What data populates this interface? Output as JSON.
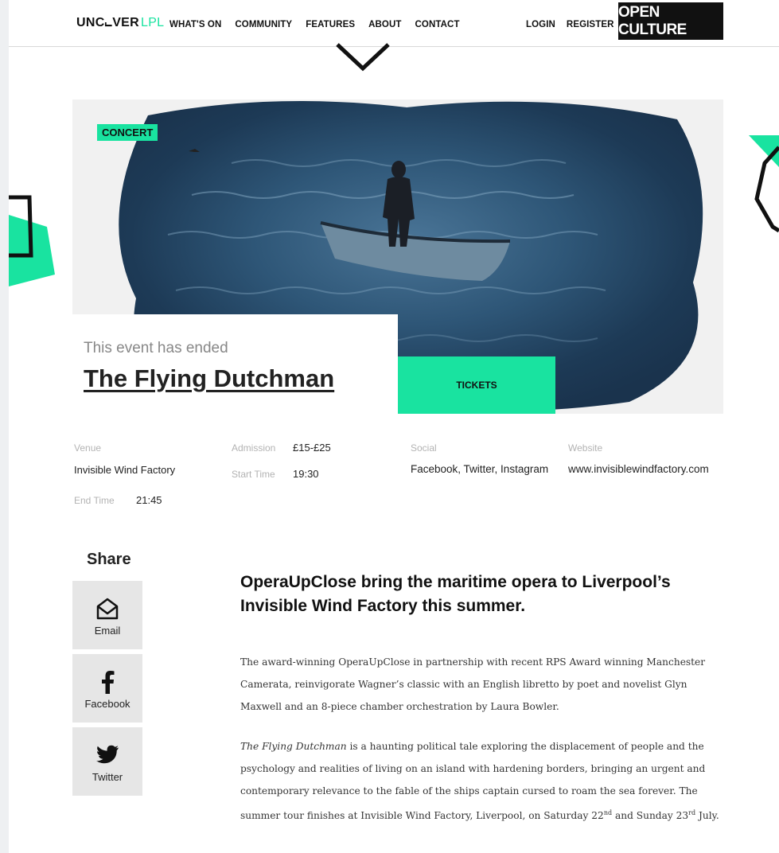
{
  "header": {
    "logo_main": "UNC⨽VER",
    "logo_accent": "LPL",
    "nav": [
      "WHAT'S ON",
      "COMMUNITY",
      "FEATURES",
      "ABOUT",
      "CONTACT"
    ],
    "login": "LOGIN",
    "register": "REGISTER",
    "brand_button": "OPEN CULTURE"
  },
  "hero": {
    "category": "CONCERT",
    "status": "This event has ended",
    "title": "The Flying Dutchman",
    "tickets_label": "TICKETS"
  },
  "details": {
    "venue_label": "Venue",
    "venue": "Invisible Wind Factory",
    "admission_label": "Admission",
    "admission": "£15-£25",
    "start_label": "Start Time",
    "start": "19:30",
    "end_label": "End Time",
    "end": "21:45",
    "social_label": "Social",
    "social": "Facebook, Twitter, Instagram",
    "website_label": "Website",
    "website": "www.invisiblewindfactory.com"
  },
  "share": {
    "title": "Share",
    "buttons": [
      {
        "label": "Email",
        "icon": "envelope-icon"
      },
      {
        "label": "Facebook",
        "icon": "facebook-icon"
      },
      {
        "label": "Twitter",
        "icon": "twitter-icon"
      }
    ]
  },
  "article": {
    "headline": "OperaUpClose bring the maritime opera to Liverpool’s Invisible Wind Factory this summer.",
    "p1": "The award-winning OperaUpClose in partnership with recent RPS Award winning Manchester Camerata, reinvigorate Wagner’s classic with an English libretto by poet and novelist Glyn Maxwell and an 8-piece chamber orchestration by Laura Bowler.",
    "p2_italic": "The Flying Dutchman",
    "p2_rest": " is a haunting political tale exploring the displacement of people and the psychology and realities of living on an island with hardening borders, bringing an urgent and contemporary relevance to the fable of the ships captain cursed to roam the sea forever. The summer tour finishes at Invisible Wind Factory, Liverpool, on Saturday 22",
    "p2_sup1": "nd",
    "p2_mid": " and Sunday 23",
    "p2_sup2": "rd",
    "p2_end": " July."
  },
  "colors": {
    "accent": "#19e3a0",
    "dark": "#111111"
  }
}
